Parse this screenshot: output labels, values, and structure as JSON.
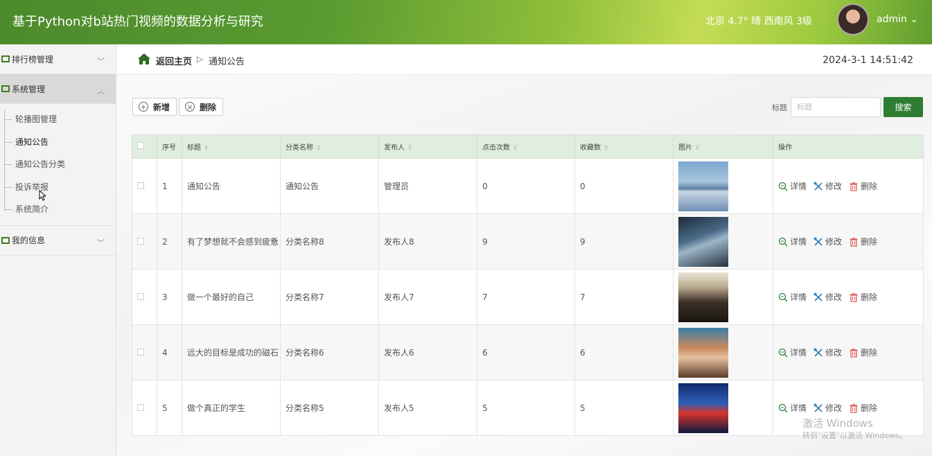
{
  "header": {
    "title": "基于Python对b站热门视频的数据分析与研究",
    "weather": "北京  4.7°  晴  西南风  3级",
    "user": "admin ⌄"
  },
  "sidebar": {
    "groups": [
      {
        "label": "排行榜管理",
        "icon": "list-icon"
      },
      {
        "label": "系统管理",
        "icon": "chart-icon"
      },
      {
        "label": "我的信息",
        "icon": "card-icon"
      }
    ],
    "system_items": [
      "轮播图管理",
      "通知公告",
      "通知公告分类",
      "投诉举报",
      "系统简介"
    ]
  },
  "breadcrumb": {
    "home": "返回主页",
    "separator": "▷",
    "current": "通知公告"
  },
  "datetime": "2024-3-1 14:51:42",
  "toolbar": {
    "add_label": "新增",
    "delete_label": "删除",
    "search_label": "标题",
    "search_placeholder": "标题",
    "search_button": "搜索"
  },
  "table": {
    "columns": [
      "序号",
      "标题",
      "分类名称",
      "发布人",
      "点击次数",
      "收藏数",
      "图片",
      "操作"
    ],
    "actions": {
      "detail": "详情",
      "edit": "修改",
      "delete": "删除"
    },
    "rows": [
      {
        "no": "1",
        "title": "通知公告",
        "category": "通知公告",
        "publisher": "管理员",
        "clicks": "0",
        "favorites": "0",
        "image": "bridge-photo"
      },
      {
        "no": "2",
        "title": "有了梦想就不会感到疲惫",
        "category": "分类名称8",
        "publisher": "发布人8",
        "clicks": "9",
        "favorites": "9",
        "image": "movie-poster-1"
      },
      {
        "no": "3",
        "title": "做一个最好的自己",
        "category": "分类名称7",
        "publisher": "发布人7",
        "clicks": "7",
        "favorites": "7",
        "image": "movie-poster-2"
      },
      {
        "no": "4",
        "title": "远大的目标是成功的磁石",
        "category": "分类名称6",
        "publisher": "发布人6",
        "clicks": "6",
        "favorites": "6",
        "image": "movie-poster-3"
      },
      {
        "no": "5",
        "title": "做个真正的学生",
        "category": "分类名称5",
        "publisher": "发布人5",
        "clicks": "5",
        "favorites": "5",
        "image": "movie-poster-4"
      }
    ]
  },
  "watermark": {
    "line1": "激活 Windows",
    "line2": "转到\"设置\"以激活 Windows。"
  },
  "colors": {
    "accent": "#2f7d32",
    "header_green": "#5a9a30",
    "table_header": "#dfeede"
  }
}
